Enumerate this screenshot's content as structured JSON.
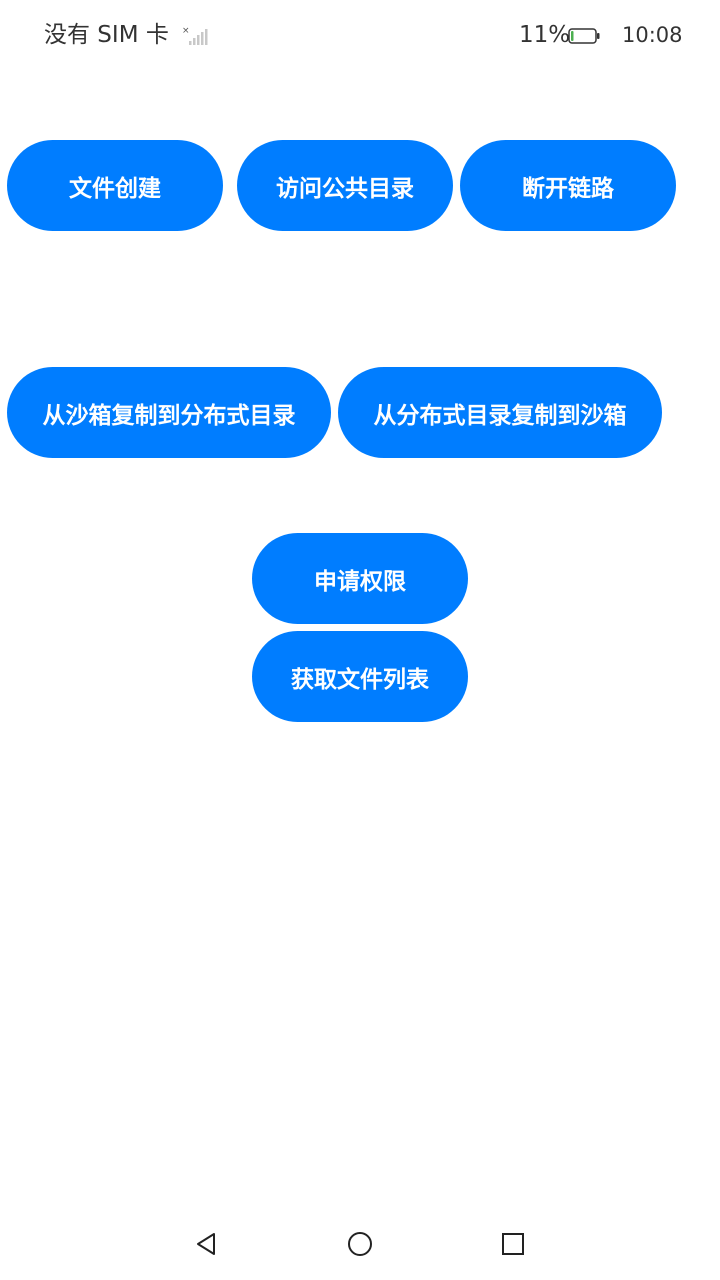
{
  "status_bar": {
    "carrier": "没有 SIM 卡",
    "battery_percent": "11%",
    "time": "10:08",
    "signal_icon": "no-signal-icon",
    "battery_icon": "battery-low-icon",
    "battery_level": 0.11,
    "battery_color": "#4caf50"
  },
  "buttons": {
    "create_file": "文件创建",
    "access_public_dir": "访问公共目录",
    "disconnect_link": "断开链路",
    "copy_sandbox_to_distributed": "从沙箱复制到分布式目录",
    "copy_distributed_to_sandbox": "从分布式目录复制到沙箱",
    "request_permission": "申请权限",
    "get_file_list": "获取文件列表"
  },
  "theme": {
    "accent": "#007dff",
    "button_text": "#ffffff",
    "background": "#ffffff"
  },
  "nav_bar": {
    "back_icon": "back-triangle-icon",
    "home_icon": "home-circle-icon",
    "recent_icon": "recent-square-icon"
  }
}
